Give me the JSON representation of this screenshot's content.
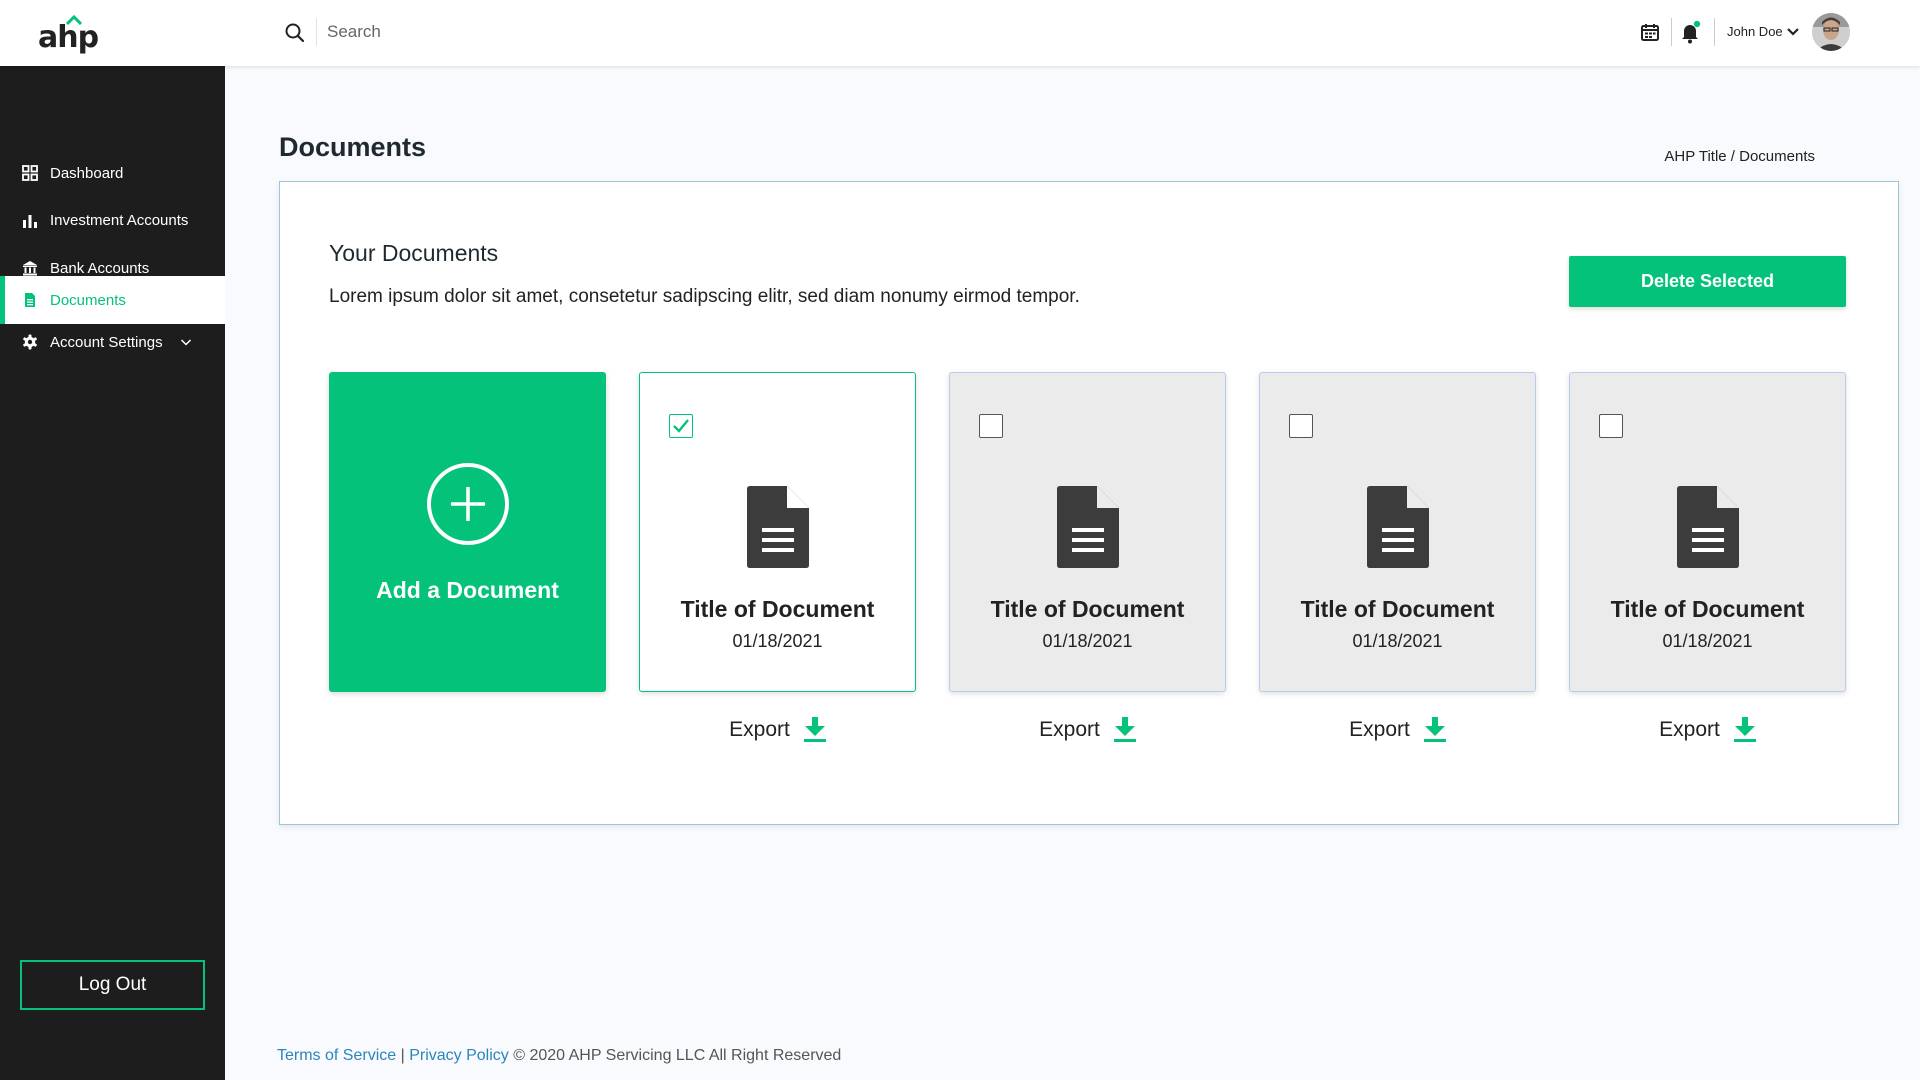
{
  "brand": {
    "logo_text": "ahp",
    "accent": "#05c27a",
    "sidebar_bg": "#1d1d1d"
  },
  "header": {
    "search_placeholder": "Search",
    "user_name": "John Doe",
    "icons": [
      "search-icon",
      "calendar-icon",
      "bell-icon",
      "chevron-down-icon"
    ]
  },
  "sidebar": {
    "items": [
      {
        "label": "Dashboard",
        "icon": "grid-icon",
        "active": false
      },
      {
        "label": "Investment Accounts",
        "icon": "bar-chart-icon",
        "active": false
      },
      {
        "label": "Bank Accounts",
        "icon": "bank-icon",
        "active": false
      },
      {
        "label": "Documents",
        "icon": "document-icon",
        "active": true
      },
      {
        "label": "Account Settings",
        "icon": "gear-icon",
        "active": false
      }
    ],
    "logout_label": "Log Out"
  },
  "page": {
    "title": "Documents",
    "breadcrumb": "AHP Title / Documents"
  },
  "panel": {
    "title": "Your Documents",
    "description": "Lorem ipsum dolor sit amet, consetetur sadipscing elitr, sed diam nonumy eirmod tempor.",
    "delete_label": "Delete Selected",
    "add_label": "Add a Document",
    "export_label": "Export",
    "documents": [
      {
        "title": "Title of Document",
        "date": "01/18/2021",
        "selected": true
      },
      {
        "title": "Title of Document",
        "date": "01/18/2021",
        "selected": false
      },
      {
        "title": "Title of Document",
        "date": "01/18/2021",
        "selected": false
      },
      {
        "title": "Title of Document",
        "date": "01/18/2021",
        "selected": false
      }
    ]
  },
  "footer": {
    "terms": "Terms of Service",
    "separator": " | ",
    "privacy": "Privacy Policy",
    "copyright": " © 2020 AHP Servicing LLC All Right Reserved"
  }
}
